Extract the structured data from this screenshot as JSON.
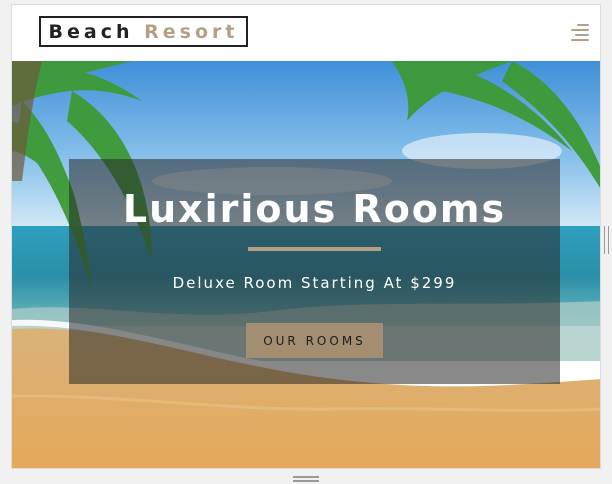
{
  "logo": {
    "word1": "Beach",
    "word2": "Resort"
  },
  "navbar": {
    "menu_icon": "hamburger-menu-icon"
  },
  "hero": {
    "title": "Luxirious Rooms",
    "subtitle": "Deluxe Room Starting At $299",
    "button_label": "OUR ROOMS",
    "background": "beach-with-palm-trees"
  },
  "colors": {
    "accent": "#b5a085",
    "button": "#a48e72",
    "overlay": "rgba(40,40,40,0.55)"
  }
}
